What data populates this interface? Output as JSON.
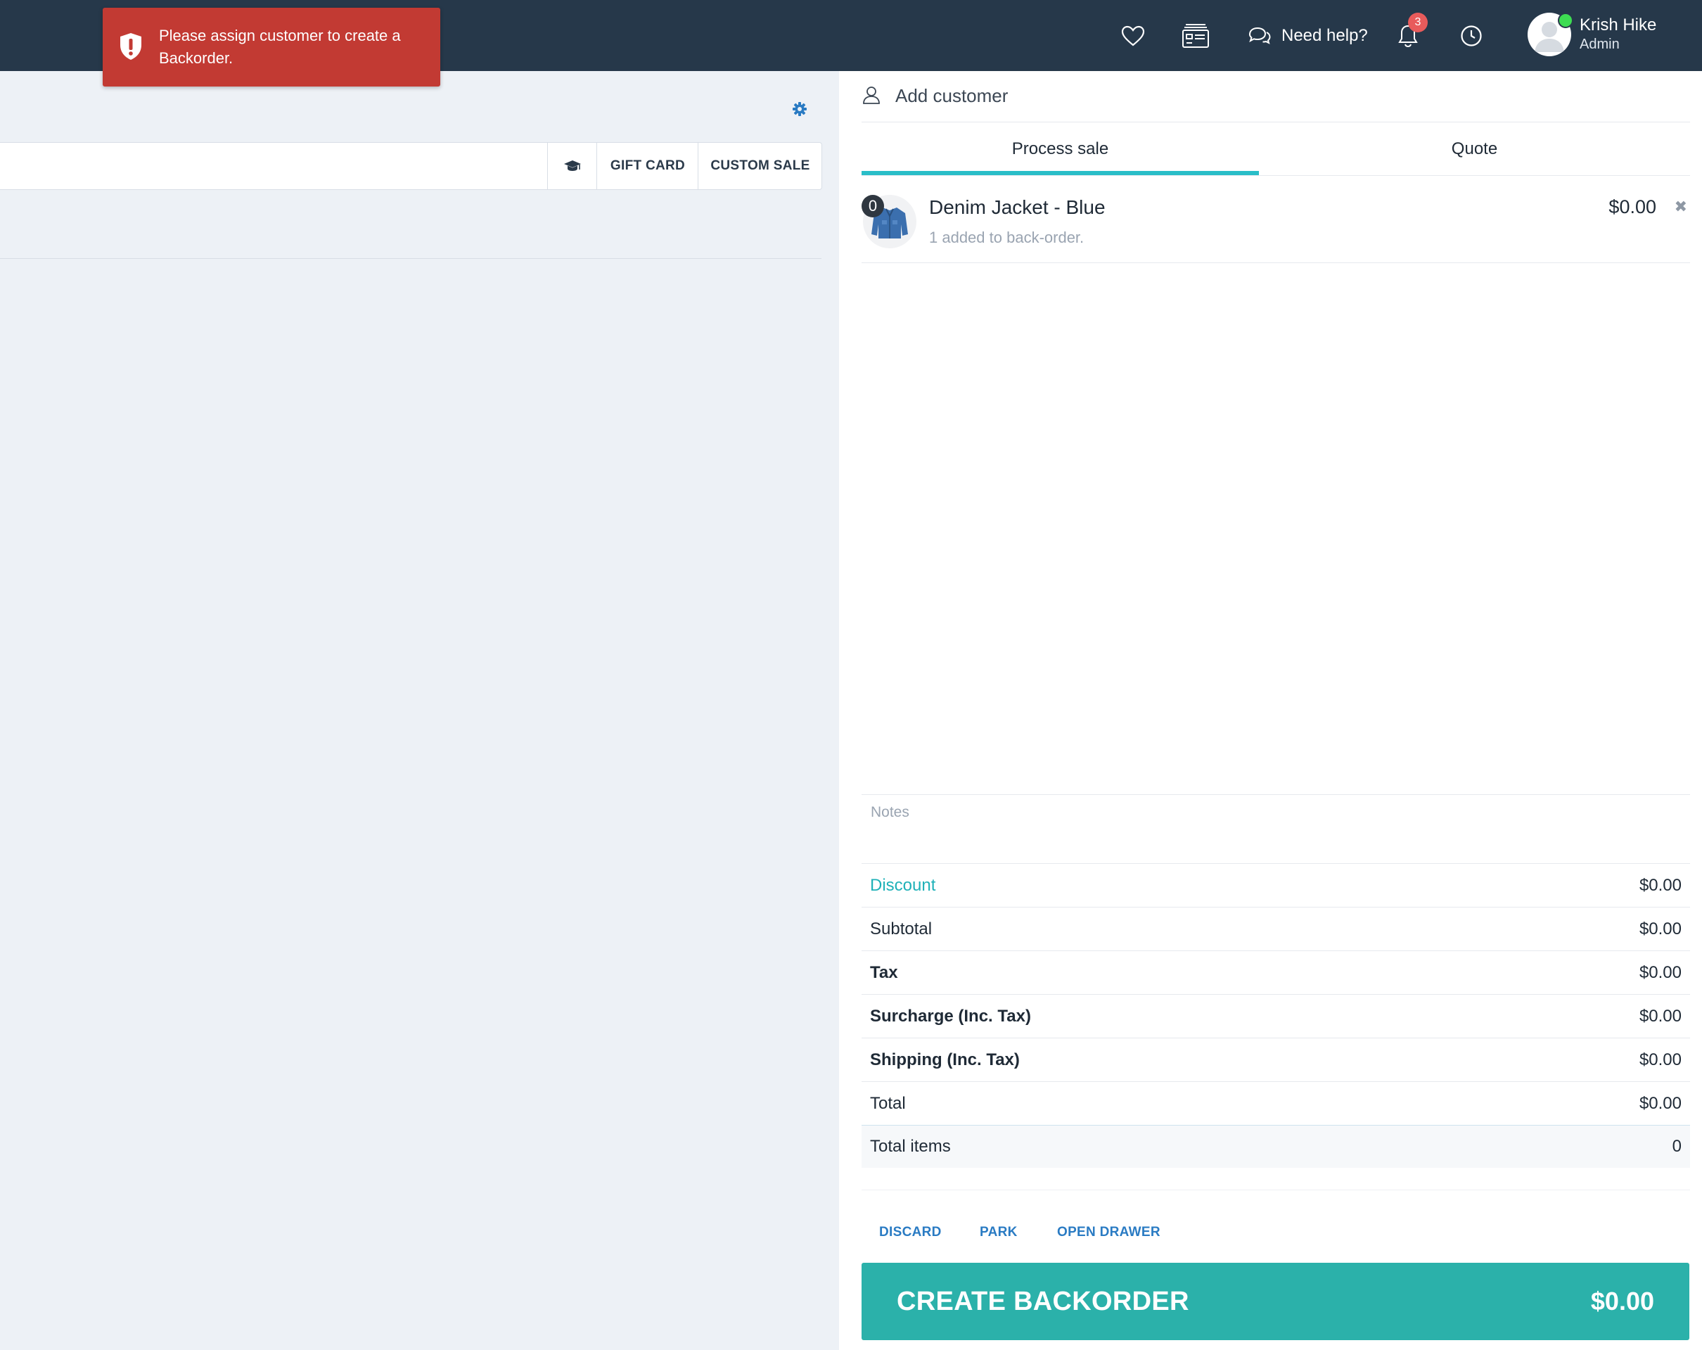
{
  "toast": {
    "message": "Please assign customer to create a Backorder."
  },
  "header": {
    "help_label": "Need help?",
    "notification_count": "3",
    "user": {
      "name": "Krish Hike",
      "role": "Admin"
    }
  },
  "left": {
    "buttons": {
      "gift_card": "GIFT CARD",
      "custom_sale": "CUSTOM SALE"
    }
  },
  "sale": {
    "add_customer_label": "Add customer",
    "tabs": [
      {
        "label": "Process sale",
        "active": true
      },
      {
        "label": "Quote",
        "active": false
      }
    ],
    "items": [
      {
        "qty": "0",
        "name": "Denim Jacket - Blue",
        "note": "1 added to back-order.",
        "price": "$0.00"
      }
    ],
    "notes_placeholder": "Notes",
    "totals": {
      "discount": {
        "label": "Discount",
        "value": "$0.00"
      },
      "subtotal": {
        "label": "Subtotal",
        "value": "$0.00"
      },
      "tax": {
        "label": "Tax",
        "value": "$0.00"
      },
      "surcharge": {
        "label": "Surcharge (Inc. Tax)",
        "value": "$0.00"
      },
      "shipping": {
        "label": "Shipping (Inc. Tax)",
        "value": "$0.00"
      },
      "total": {
        "label": "Total",
        "value": "$0.00"
      },
      "total_items": {
        "label": "Total items",
        "value": "0"
      }
    },
    "actions": {
      "discard": "DISCARD",
      "park": "PARK",
      "open_drawer": "OPEN DRAWER"
    },
    "cta": {
      "label": "CREATE BACKORDER",
      "amount": "$0.00"
    }
  },
  "colors": {
    "topbar": "#26384a",
    "toast": "#c23a33",
    "accent": "#29bec8",
    "cta": "#2bb1aa",
    "link": "#2a7bc3"
  }
}
